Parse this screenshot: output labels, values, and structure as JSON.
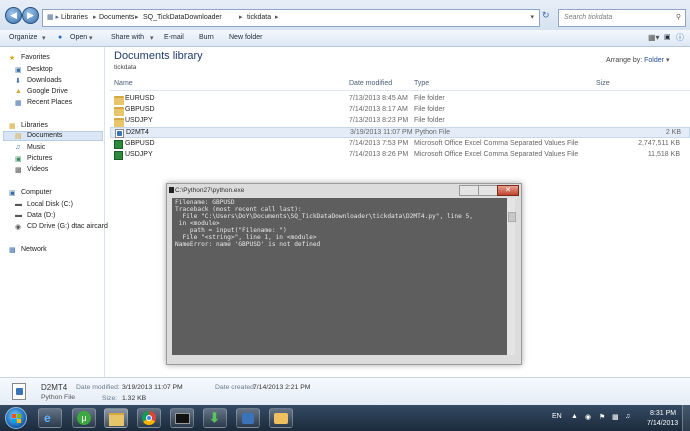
{
  "address": {
    "crumbs": [
      "Libraries",
      "Documents",
      "SQ_TickDataDownloader",
      "tickdata"
    ],
    "search_placeholder": "Search tickdata"
  },
  "toolbar": {
    "organize": "Organize",
    "open": "Open",
    "share_with": "Share with",
    "email": "E-mail",
    "burn": "Burn",
    "new_folder": "New folder"
  },
  "nav": {
    "favorites": "Favorites",
    "favorites_items": [
      "Desktop",
      "Downloads",
      "Google Drive",
      "Recent Places"
    ],
    "libraries": "Libraries",
    "libraries_items": [
      "Documents",
      "Music",
      "Pictures",
      "Videos"
    ],
    "computer": "Computer",
    "computer_items": [
      "Local Disk (C:)",
      "Data (D:)",
      "CD Drive (G:) dtac aircard"
    ],
    "network": "Network"
  },
  "library": {
    "title": "Documents library",
    "subtitle": "tickdata",
    "arrange_label": "Arrange by:",
    "arrange_value": "Folder"
  },
  "columns": {
    "name": "Name",
    "date": "Date modified",
    "type": "Type",
    "size": "Size"
  },
  "files": [
    {
      "name": "EURUSD",
      "date": "7/13/2013 8:45 AM",
      "type": "File folder",
      "size": "",
      "kind": "folder"
    },
    {
      "name": "GBPUSD",
      "date": "7/14/2013 8:17 AM",
      "type": "File folder",
      "size": "",
      "kind": "folder"
    },
    {
      "name": "USDJPY",
      "date": "7/13/2013 8:23 PM",
      "type": "File folder",
      "size": "",
      "kind": "folder"
    },
    {
      "name": "D2MT4",
      "date": "3/19/2013 11:07 PM",
      "type": "Python File",
      "size": "2 KB",
      "kind": "py"
    },
    {
      "name": "GBPUSD",
      "date": "7/14/2013 7:53 PM",
      "type": "Microsoft Office Excel Comma Separated Values File",
      "size": "2,747,511 KB",
      "kind": "csv"
    },
    {
      "name": "USDJPY",
      "date": "7/14/2013 8:26 PM",
      "type": "Microsoft Office Excel Comma Separated Values File",
      "size": "11,518 KB",
      "kind": "csv"
    }
  ],
  "console": {
    "title": "C:\\Python27\\python.exe",
    "lines": [
      "Filename: GBPUSD",
      "Traceback (most recent call last):",
      "  File \"C:\\Users\\DoY\\Documents\\SQ_TickDataDownloader\\tickdata\\D2MT4.py\", line 5,",
      " in <module>",
      "    path = input(\"Filename: \")",
      "  File \"<string>\", line 1, in <module>",
      "NameError: name 'GBPUSD' is not defined"
    ]
  },
  "details": {
    "name": "D2MT4",
    "type": "Python File",
    "modified_label": "Date modified:",
    "modified_value": "3/19/2013 11:07 PM",
    "created_label": "Date created:",
    "created_value": "7/14/2013 2:21 PM",
    "size_label": "Size:",
    "size_value": "1.32 KB"
  },
  "taskbar": {
    "language": "EN",
    "time": "8:31 PM",
    "date": "7/14/2013"
  }
}
